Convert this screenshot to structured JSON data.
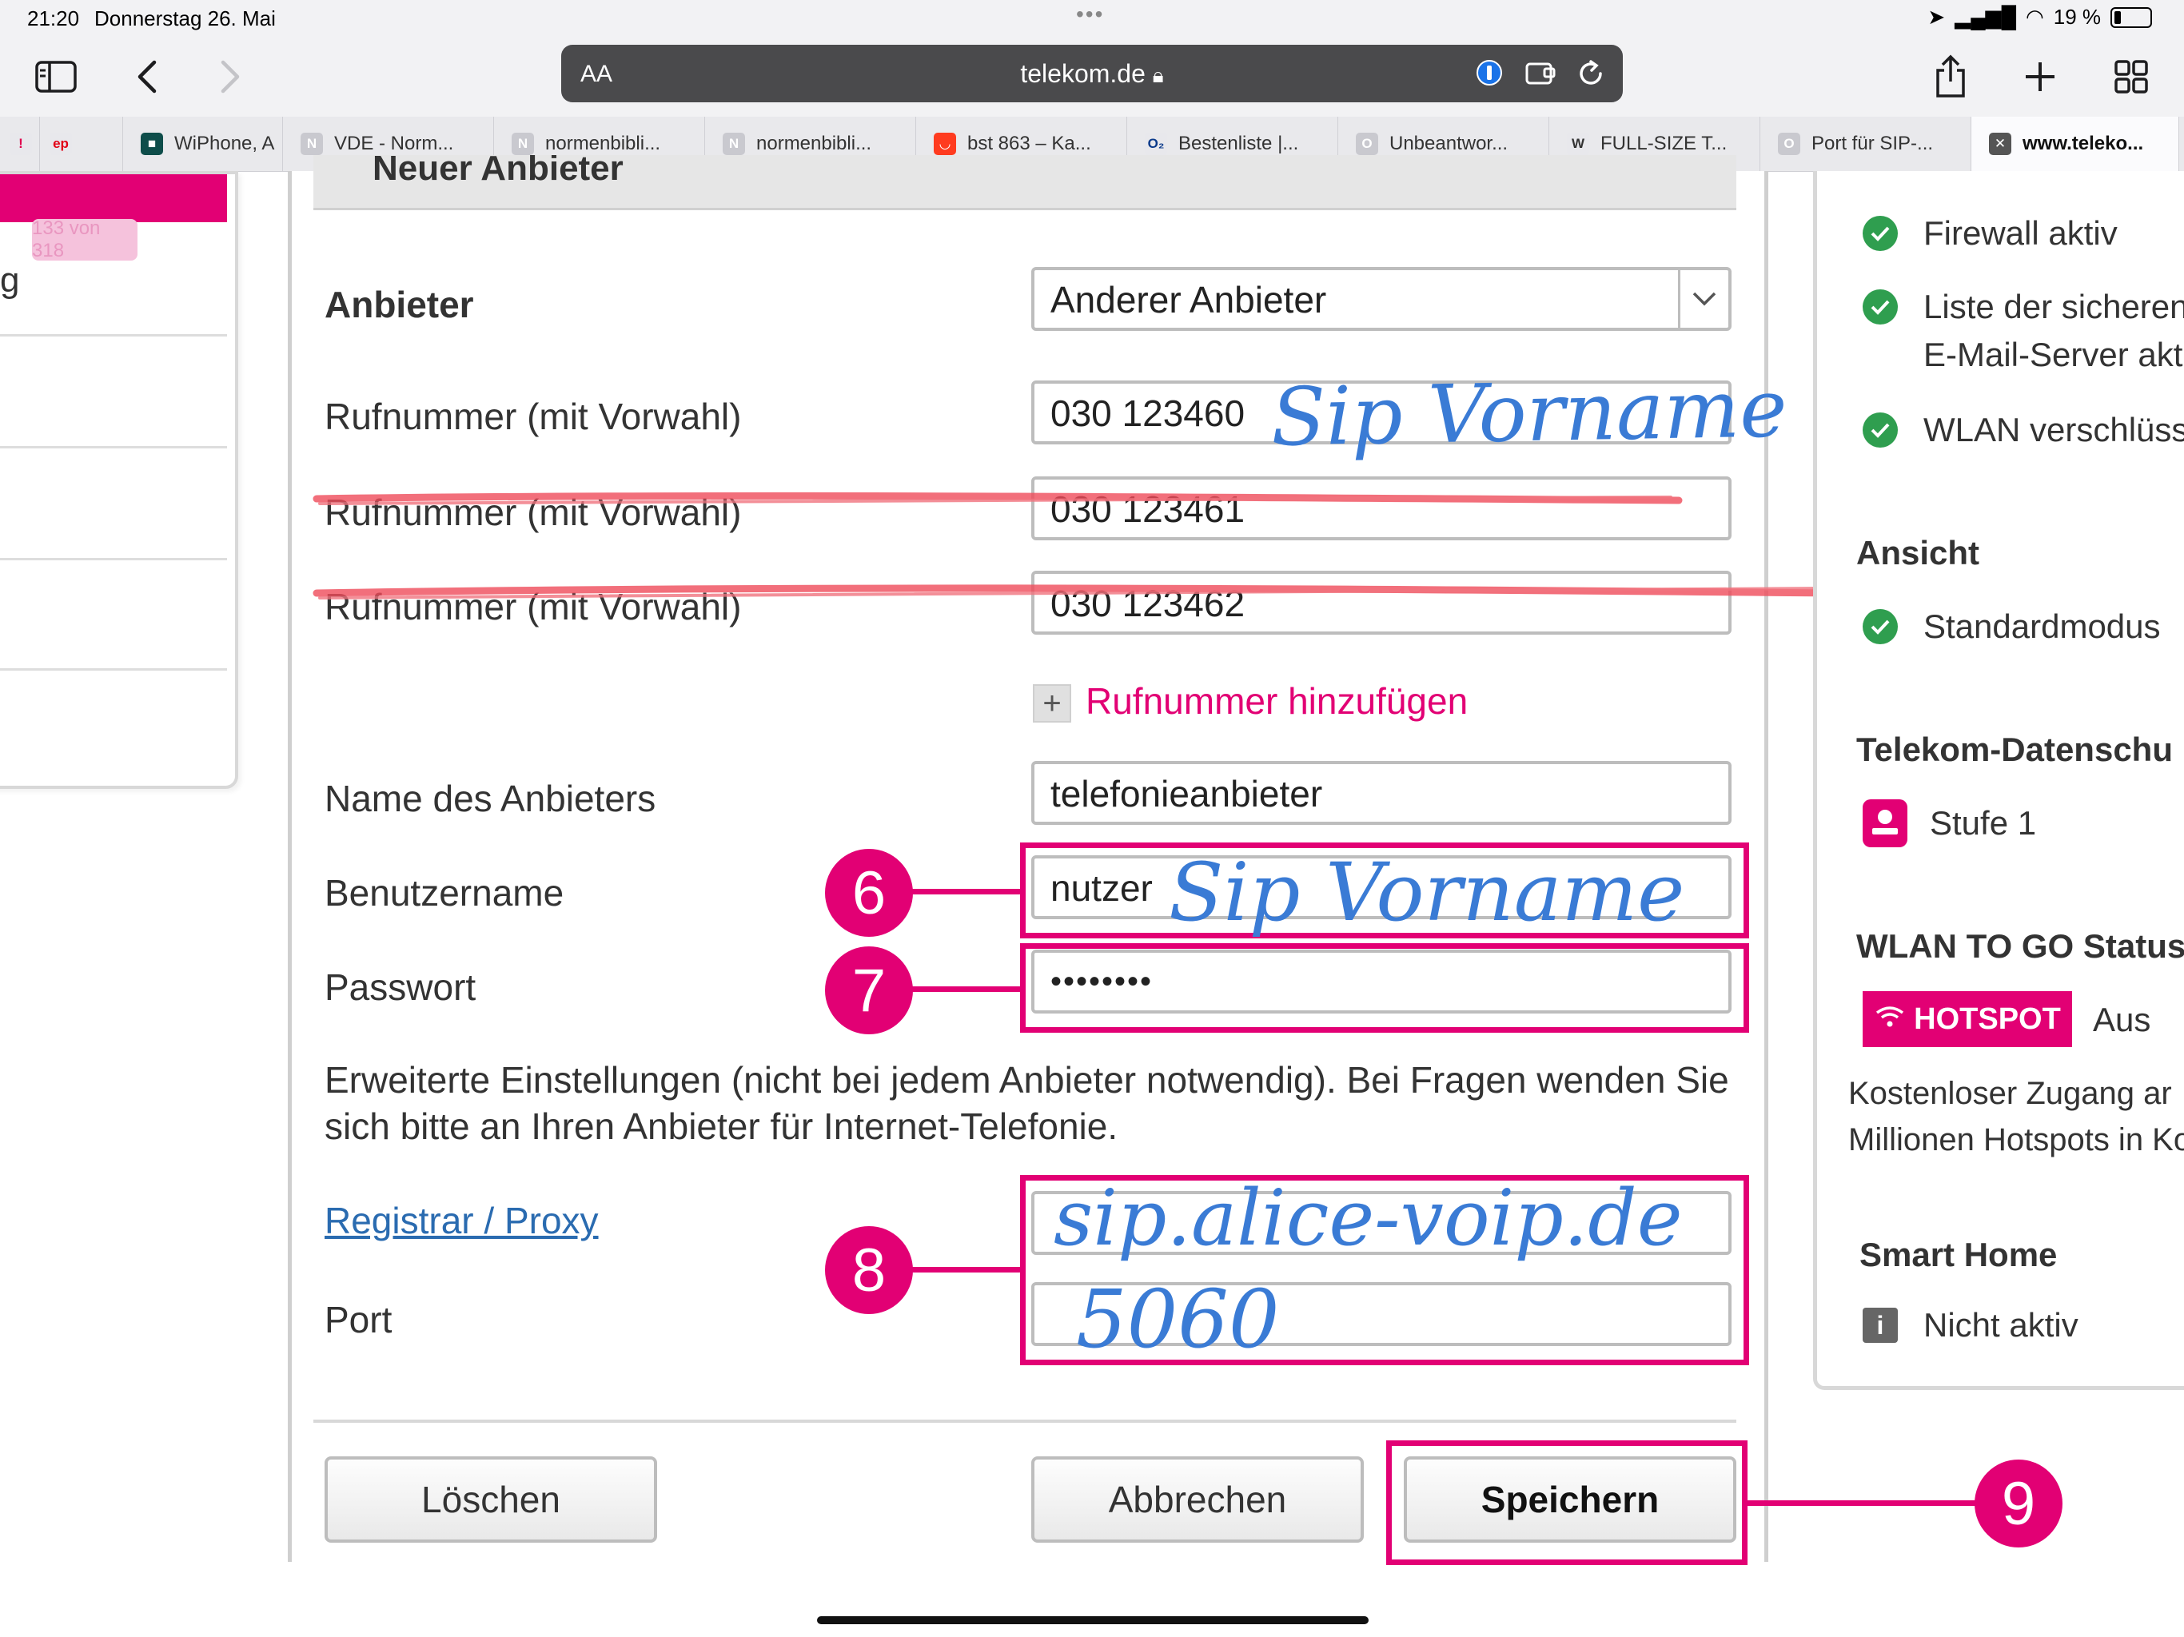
{
  "status_bar": {
    "time": "21:20",
    "date": "Donnerstag 26. Mai",
    "battery": "19 %"
  },
  "browser": {
    "aa_label": "AA",
    "url": "telekom.de",
    "tabs": [
      {
        "label": "",
        "fav": "!",
        "color": "#e8e8ec",
        "fg": "#e0004d"
      },
      {
        "label": "",
        "fav": "ep",
        "color": "#e8e8ec",
        "fg": "#e20015"
      },
      {
        "label": "WiPhone, A",
        "fav": "■",
        "color": "#0e4d4a",
        "fg": "#ffffff"
      },
      {
        "label": "VDE - Norm...",
        "fav": "N",
        "color": "#c9c9cf",
        "fg": "#ffffff"
      },
      {
        "label": "normenbibli...",
        "fav": "N",
        "color": "#c9c9cf",
        "fg": "#ffffff"
      },
      {
        "label": "normenbibli...",
        "fav": "N",
        "color": "#c9c9cf",
        "fg": "#ffffff"
      },
      {
        "label": "bst 863 – Ka...",
        "fav": "◡",
        "color": "#ff3b1f",
        "fg": "#ffffff"
      },
      {
        "label": "Bestenliste |...",
        "fav": "O₂",
        "color": "#e8e8ec",
        "fg": "#0a3a8a"
      },
      {
        "label": "Unbeantwor...",
        "fav": "O",
        "color": "#c9c9cf",
        "fg": "#ffffff"
      },
      {
        "label": "FULL-SIZE T...",
        "fav": "W",
        "color": "#e8e8ec",
        "fg": "#333333"
      },
      {
        "label": "Port für SIP-...",
        "fav": "O",
        "color": "#c9c9cf",
        "fg": "#ffffff"
      },
      {
        "label": "www.teleko...",
        "fav": "✕",
        "color": "#555555",
        "fg": "#ffffff",
        "active": true
      }
    ]
  },
  "left_panel": {
    "counter": "133 von 318",
    "partial_text": "g"
  },
  "form": {
    "section_title": "Neuer Anbieter",
    "provider_label": "Anbieter",
    "provider_value": "Anderer Anbieter",
    "phone_label": "Rufnummer (mit Vorwahl)",
    "phone_values": [
      "030 123460",
      "030 123461",
      "030 123462"
    ],
    "add_number": "Rufnummer hinzufügen",
    "provider_name_label": "Name des Anbieters",
    "provider_name_value": "telefonieanbieter",
    "username_label": "Benutzername",
    "username_value": "nutzer",
    "password_label": "Passwort",
    "password_value": "••••••••",
    "advanced_info": "Erweiterte Einstellungen (nicht bei jedem Anbieter notwendig). Bei Fragen wenden Sie sich bitte an Ihren Anbieter für Internet-Telefonie.",
    "registrar_label": "Registrar / Proxy",
    "port_label": "Port",
    "buttons": {
      "delete": "Löschen",
      "cancel": "Abbrechen",
      "save": "Speichern"
    }
  },
  "annotations": {
    "steps": [
      "6",
      "7",
      "8",
      "9"
    ],
    "handwriting": {
      "phone_note": "Sip Vorname",
      "username_note": "Sip Vorname",
      "registrar_note": "sip.alice-voip.de",
      "port_note": "5060"
    },
    "accent_color": "#e20074",
    "handwriting_color": "#3a7bd5",
    "strike_color": "#ef4b5a"
  },
  "right_panel": {
    "items": [
      {
        "text": "Firewall aktiv"
      },
      {
        "text": "Liste der sicheren"
      },
      {
        "text": "E-Mail-Server akti"
      },
      {
        "text": "WLAN verschlüss"
      }
    ],
    "view_heading": "Ansicht",
    "view_mode": "Standardmodus",
    "privacy_heading": "Telekom-Datenschu",
    "privacy_level": "Stufe 1",
    "wlan_heading": "WLAN TO GO Status",
    "hotspot_label": "HOTSPOT",
    "hotspot_state": "Aus",
    "hotspot_info_1": "Kostenloser Zugang ar",
    "hotspot_info_2": "Millionen Hotspots in Ko",
    "smart_home_heading": "Smart Home",
    "smart_home_state": "Nicht aktiv"
  }
}
